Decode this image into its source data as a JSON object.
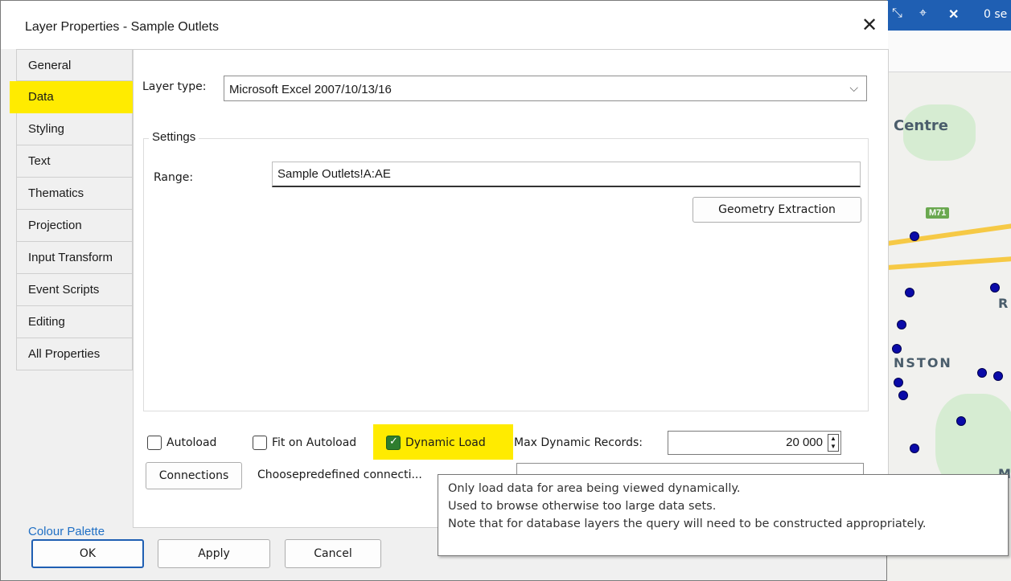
{
  "window": {
    "title": "Layer Properties - Sample Outlets",
    "close_glyph": "✕"
  },
  "tabs": [
    {
      "label": "General"
    },
    {
      "label": "Data"
    },
    {
      "label": "Styling"
    },
    {
      "label": "Text"
    },
    {
      "label": "Thematics"
    },
    {
      "label": "Projection"
    },
    {
      "label": "Input Transform"
    },
    {
      "label": "Event Scripts"
    },
    {
      "label": "Editing"
    },
    {
      "label": "All Properties"
    }
  ],
  "active_tab": "Data",
  "colour_palette_link": "Colour Palette",
  "data_panel": {
    "layer_type_label": "Layer type:",
    "layer_type_value": "Microsoft Excel 2007/10/13/16",
    "settings_title": "Settings",
    "range_label": "Range:",
    "range_value": "Sample Outlets!A:AE",
    "geometry_button": "Geometry Extraction",
    "autoload_label": "Autoload",
    "autoload_checked": false,
    "fit_on_autoload_label": "Fit on Autoload",
    "fit_on_autoload_checked": false,
    "dynamic_load_label": "Dynamic Load",
    "dynamic_load_checked": true,
    "max_dynamic_records_label": "Max Dynamic Records:",
    "max_dynamic_records_value": "20 000",
    "connections_button": "Connections",
    "choose_predefined_label": "Choosepredefined connecti..."
  },
  "tooltip": {
    "lines": [
      "Only load data for area being viewed dynamically.",
      "Used to browse otherwise too large data sets.",
      "Note that for database layers the query will need to be constructed appropriately."
    ]
  },
  "footer": {
    "ok": "OK",
    "apply": "Apply",
    "cancel": "Cancel"
  },
  "map": {
    "status_text": "0 se",
    "labels": [
      "Centre",
      "M71",
      "R",
      "NSTON",
      "M"
    ]
  },
  "colors": {
    "highlight": "#ffeb00",
    "accent": "#1f5fb3",
    "link": "#1f6fc5",
    "map_point": "#0a0aa8",
    "check_green": "#2e7d2e"
  }
}
